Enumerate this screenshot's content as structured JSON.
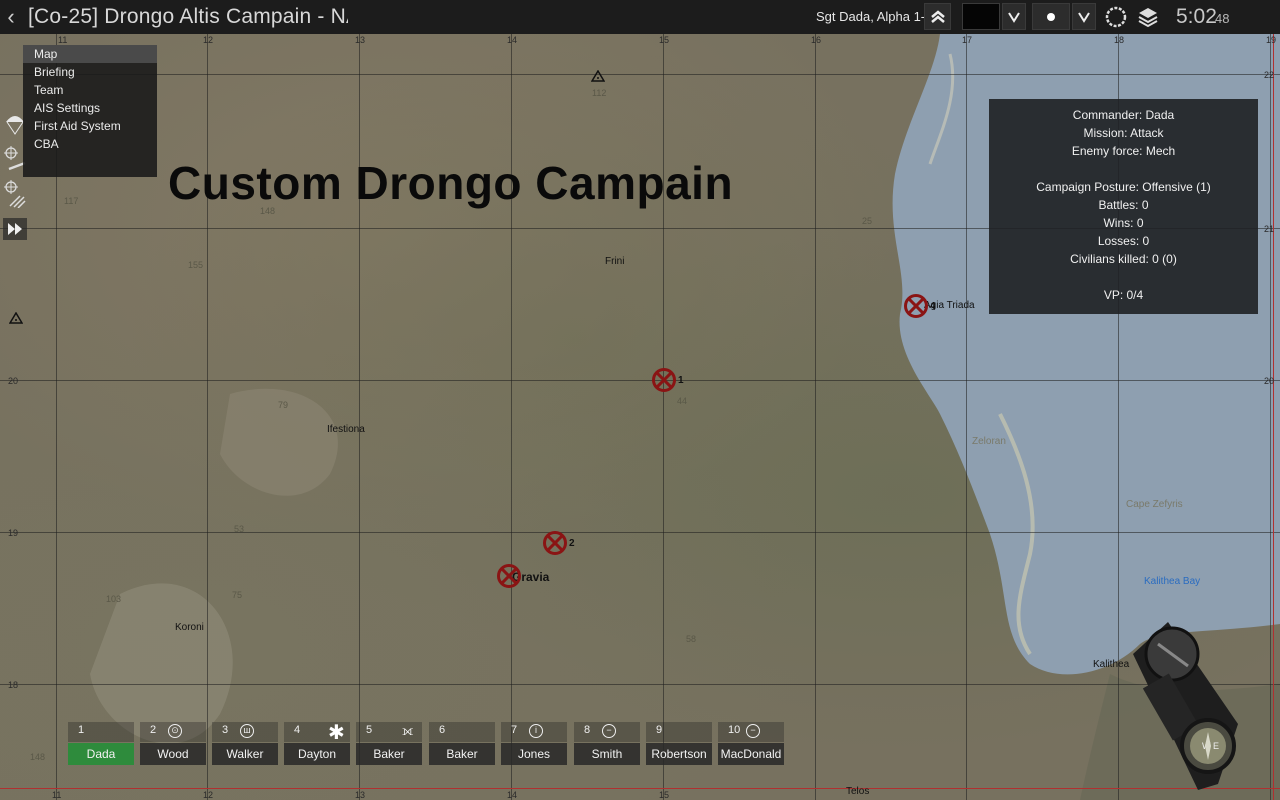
{
  "topbar": {
    "back_icon": "chevron-left-icon",
    "title": "[Co-25] Drongo Altis Campain - NAT",
    "rank_text": "Sgt Dada, Alpha 1-1 1",
    "rank_icon": "rank-chevrons-icon",
    "clock_hm": "5:02",
    "clock_s": "48"
  },
  "menu": {
    "items": [
      "Map",
      "Briefing",
      "Team",
      "AIS Settings",
      "First Aid System",
      "CBA"
    ]
  },
  "map": {
    "overlay_title": "Custom Drongo Campain",
    "towns": [
      "Frini",
      "Ifestiona",
      "Koroni",
      "Kalithea",
      "Telos",
      "Agia Triada",
      "Zeloran",
      "Cape Zefyris",
      "Kalithea Bay",
      "Gravia"
    ],
    "grid_x": [
      "11",
      "12",
      "13",
      "14",
      "15",
      "16",
      "17",
      "18",
      "19"
    ],
    "grid_y": [
      "22",
      "21",
      "20",
      "19",
      "18"
    ],
    "elevations": [
      "112",
      "117",
      "148",
      "155",
      "79",
      "53",
      "103",
      "75",
      "58",
      "44",
      "25",
      "36",
      "113"
    ],
    "markers": [
      {
        "label": "1"
      },
      {
        "label": "2"
      },
      {
        "label": "3"
      },
      {
        "label": "4"
      }
    ]
  },
  "info": {
    "commander": "Commander:  Dada",
    "mission": "Mission:  Attack",
    "enemy": "Enemy force:  Mech",
    "posture": "Campaign Posture:  Offensive (1)",
    "battles": "Battles:  0",
    "wins": "Wins:  0",
    "losses": "Losses:  0",
    "civilians": "Civilians killed:  0 (0)",
    "vp": "VP: 0/4"
  },
  "squad": [
    {
      "num": "1",
      "name": "Dada",
      "icon": "",
      "selected": true
    },
    {
      "num": "2",
      "name": "Wood",
      "icon": "grenadier-icon"
    },
    {
      "num": "3",
      "name": "Walker",
      "icon": "autorifle-icon"
    },
    {
      "num": "4",
      "name": "Dayton",
      "icon": "medic-icon"
    },
    {
      "num": "5",
      "name": "Baker",
      "icon": "engineer-icon"
    },
    {
      "num": "6",
      "name": "Baker",
      "icon": ""
    },
    {
      "num": "7",
      "name": "Jones",
      "icon": "info-icon"
    },
    {
      "num": "8",
      "name": "Smith",
      "icon": "minus-icon"
    },
    {
      "num": "9",
      "name": "Robertson",
      "icon": ""
    },
    {
      "num": "10",
      "name": "MacDonald",
      "icon": "minus-icon"
    }
  ],
  "colors": {
    "marker": "#8a1414",
    "selected": "#2e8b3c",
    "sea": "#8a9db0"
  }
}
